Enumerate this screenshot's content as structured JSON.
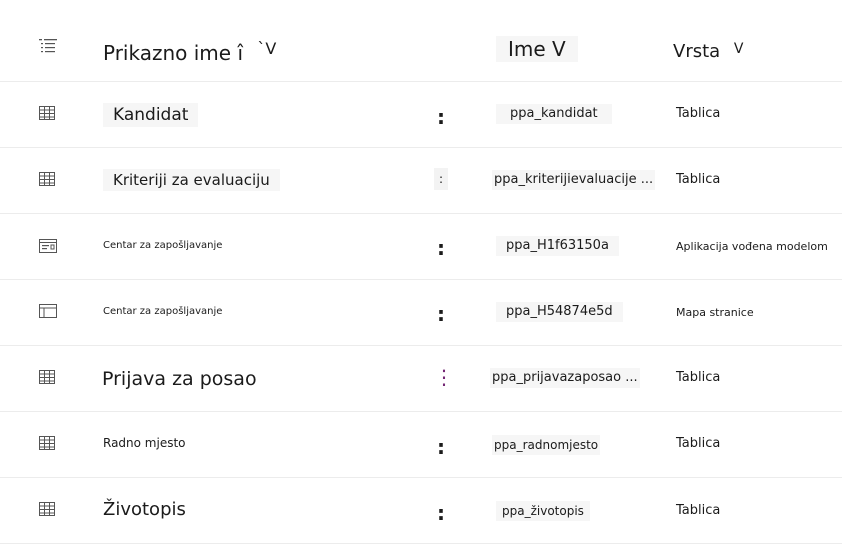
{
  "header": {
    "icon": "list-icon",
    "display_name_label": "Prikazno ime",
    "display_name_sort": "î",
    "display_name_arrow": "`V",
    "name_label": "Ime V",
    "type_label": "Vrsta",
    "type_arrow": "V"
  },
  "rows": [
    {
      "icon": "table-icon",
      "display_name": "Kandidat",
      "more": ":",
      "name": "ppa_kandidat",
      "type": "Tablica"
    },
    {
      "icon": "table-icon",
      "display_name": "Kriteriji za evaluaciju",
      "more": ":",
      "name": "ppa_kriterijievaluacije ...",
      "type": "Tablica"
    },
    {
      "icon": "model-driven-app-icon",
      "display_name": "Centar za zapošljavanje",
      "more": ":",
      "name": "ppa_H1f63150a",
      "type": "Aplikacija vođena modelom"
    },
    {
      "icon": "site-map-icon",
      "display_name": "Centar za zapošljavanje",
      "more": ":",
      "name": "ppa_H54874e5d",
      "type": "Mapa stranice"
    },
    {
      "icon": "table-icon",
      "display_name": "Prijava za posao",
      "more": "⋮",
      "name": "ppa_prijavazaposao ...",
      "type": "Tablica"
    },
    {
      "icon": "table-icon",
      "display_name": "Radno mjesto",
      "more": ":",
      "name": "ppa_radnomjesto",
      "type": "Tablica"
    },
    {
      "icon": "table-icon",
      "display_name": "Životopis",
      "more": ":",
      "name": "ppa_životopis",
      "type": "Tablica"
    }
  ],
  "colors": {
    "accent": "#742774",
    "divider": "#ececec",
    "text": "#1b1b1b"
  }
}
